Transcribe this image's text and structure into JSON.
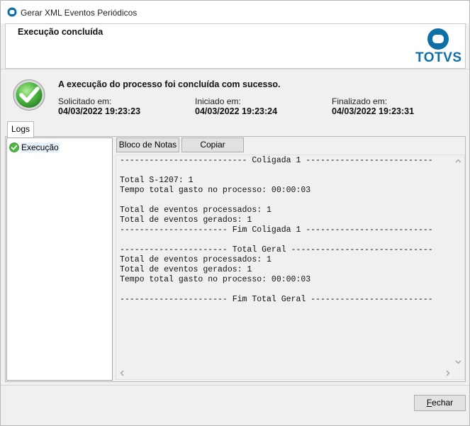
{
  "window": {
    "title": "Gerar XML Eventos Periódicos"
  },
  "header": {
    "title": "Execução concluída",
    "logo_text": "TOTVS"
  },
  "status": {
    "message": "A execução do processo foi concluída com sucesso.",
    "requested_label": "Solicitado em:",
    "requested_value": "04/03/2022 19:23:23",
    "started_label": "Iniciado em:",
    "started_value": "04/03/2022 19:23:24",
    "finished_label": "Finalizado em:",
    "finished_value": "04/03/2022 19:23:31"
  },
  "tabs": {
    "logs": "Logs"
  },
  "tree": {
    "items": [
      {
        "label": "Execução"
      }
    ]
  },
  "toolbar": {
    "notepad": "Bloco de Notas",
    "copy": "Copiar"
  },
  "log": {
    "text": "-------------------------- Coligada 1 --------------------------\n\nTotal S-1207: 1\nTempo total gasto no processo: 00:00:03\n\nTotal de eventos processados: 1\nTotal de eventos gerados: 1\n---------------------- Fim Coligada 1 --------------------------\n\n---------------------- Total Geral -----------------------------\nTotal de eventos processados: 1\nTotal de eventos gerados: 1\nTempo total gasto no processo: 00:00:03\n\n---------------------- Fim Total Geral -------------------------"
  },
  "footer": {
    "close_first": "F",
    "close_rest": "echar"
  },
  "colors": {
    "brand": "#0e6ea6",
    "success": "#3aa63a"
  }
}
